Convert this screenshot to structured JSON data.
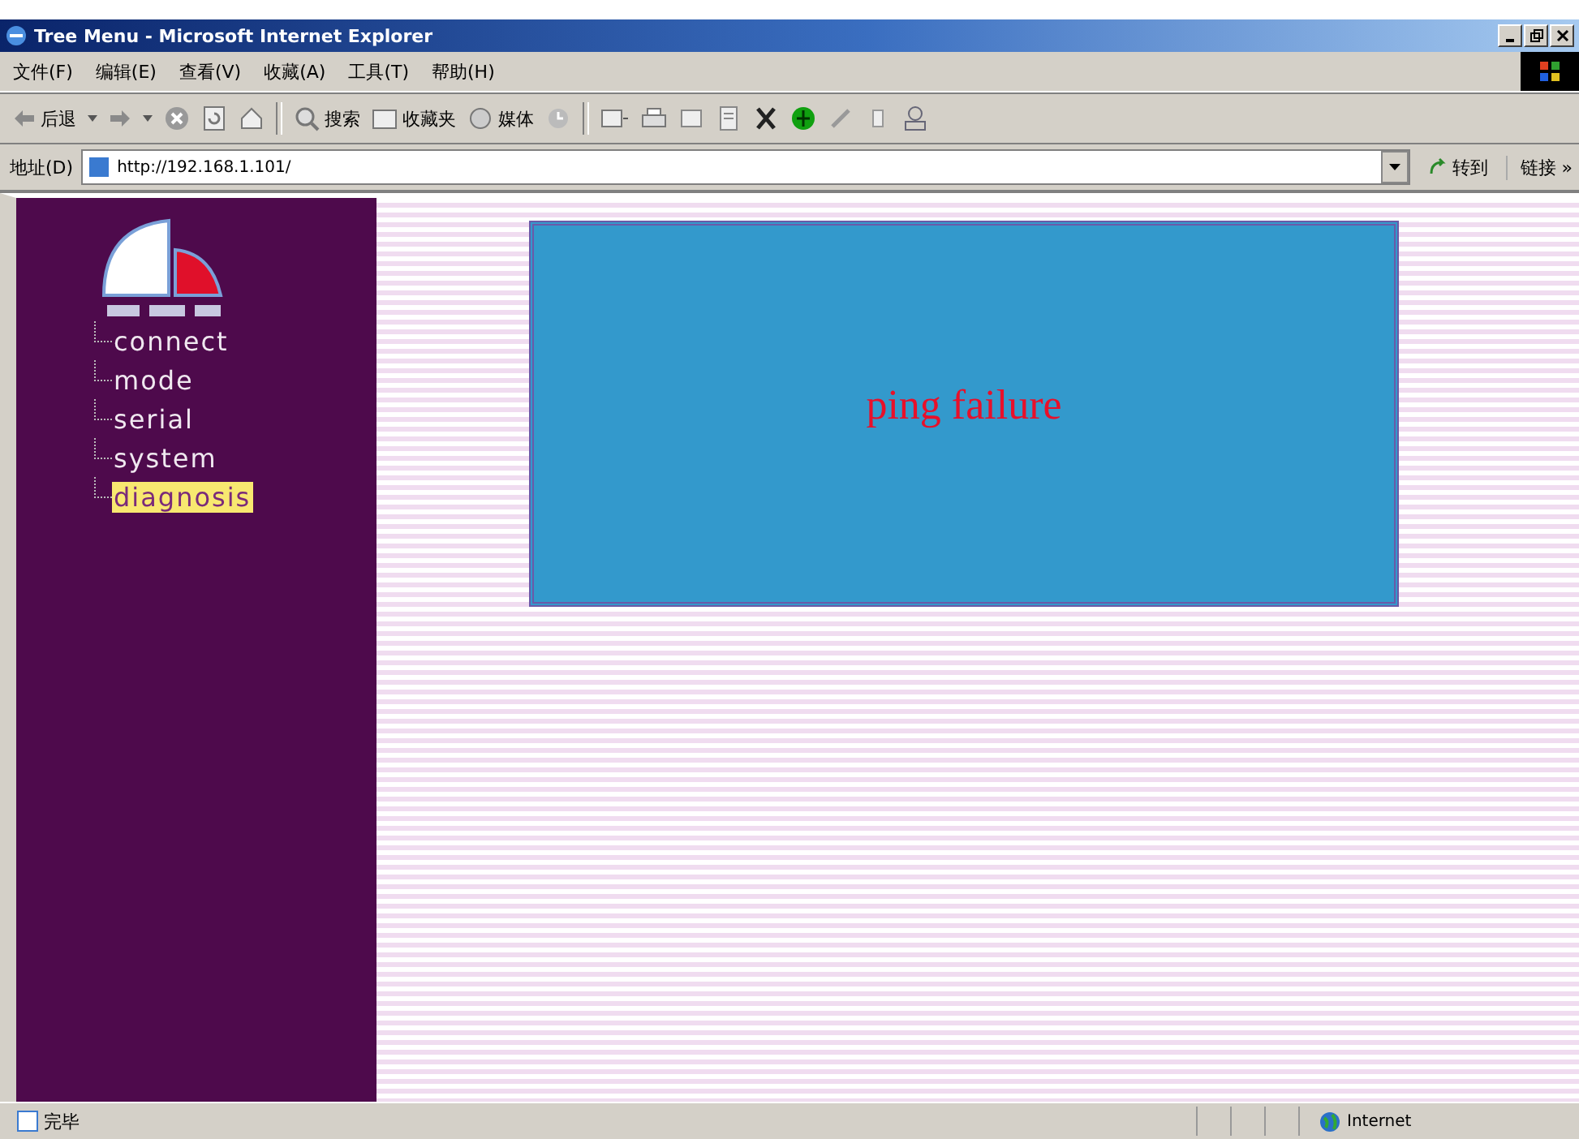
{
  "window": {
    "title": "Tree Menu - Microsoft Internet Explorer"
  },
  "menu_bar": [
    "文件(F)",
    "编辑(E)",
    "查看(V)",
    "收藏(A)",
    "工具(T)",
    "帮助(H)"
  ],
  "toolbar": {
    "back": "后退",
    "search": "搜索",
    "favorites": "收藏夹",
    "media": "媒体"
  },
  "address_bar": {
    "label": "地址(D)",
    "value": "http://192.168.1.101/",
    "go": "转到",
    "links": "链接 »"
  },
  "sidebar": {
    "items": [
      {
        "label": "connect",
        "selected": false
      },
      {
        "label": "mode",
        "selected": false
      },
      {
        "label": "serial",
        "selected": false
      },
      {
        "label": "system",
        "selected": false
      },
      {
        "label": "diagnosis",
        "selected": true
      }
    ]
  },
  "content": {
    "message": "ping failure"
  },
  "status_bar": {
    "text": "完毕",
    "zone": "Internet"
  }
}
